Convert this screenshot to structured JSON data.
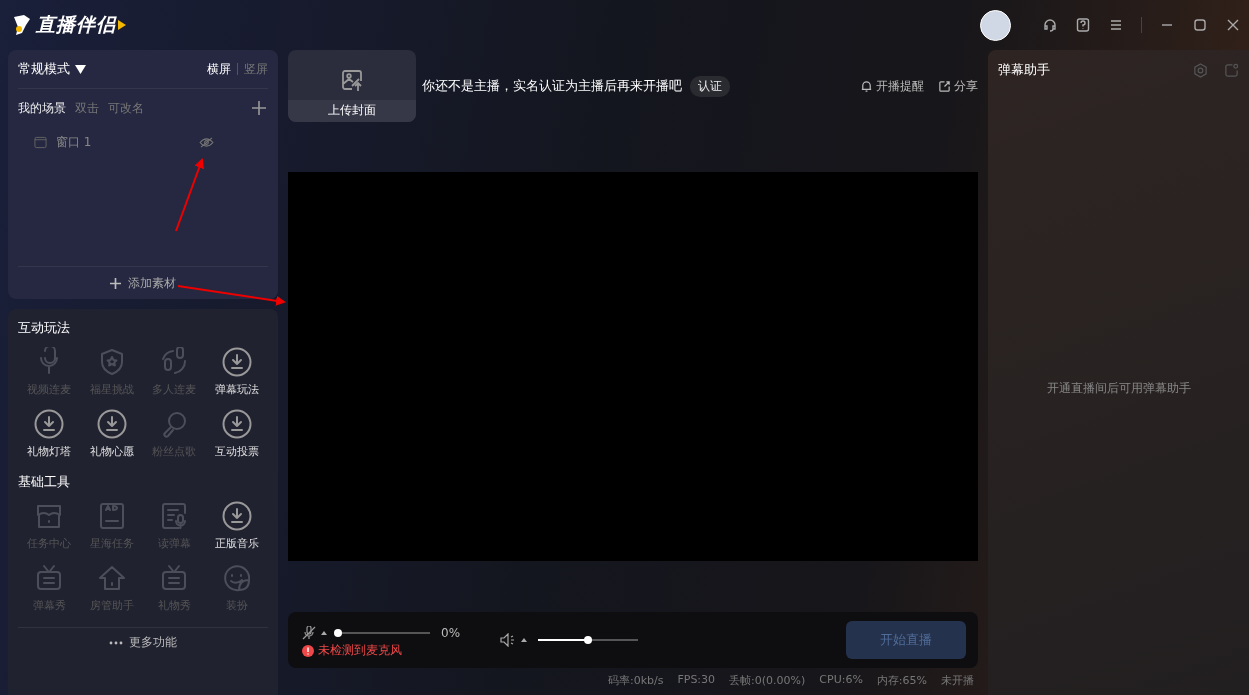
{
  "app": {
    "title": "直播伴侣"
  },
  "scenes": {
    "mode": "常规模式",
    "orientations": [
      {
        "label": "横屏",
        "selected": true
      },
      {
        "label": "竖屏",
        "selected": false
      }
    ],
    "title": "我的场景",
    "hint": [
      "双击",
      "可改名"
    ],
    "items": [
      {
        "label": "窗口 1",
        "visible": false
      }
    ],
    "add_label": "添加素材"
  },
  "tool_sections": [
    {
      "title": "互动玩法",
      "items": [
        {
          "label": "视频连麦",
          "kind": "mic",
          "disabled": true
        },
        {
          "label": "福星挑战",
          "kind": "shield",
          "disabled": true
        },
        {
          "label": "多人连麦",
          "kind": "multi",
          "disabled": true
        },
        {
          "label": "弹幕玩法",
          "kind": "download",
          "disabled": false
        },
        {
          "label": "礼物灯塔",
          "kind": "download",
          "disabled": false
        },
        {
          "label": "礼物心愿",
          "kind": "download",
          "disabled": false
        },
        {
          "label": "粉丝点歌",
          "kind": "note",
          "disabled": true
        },
        {
          "label": "互动投票",
          "kind": "download",
          "disabled": false
        }
      ]
    },
    {
      "title": "基础工具",
      "items": [
        {
          "label": "任务中心",
          "kind": "store",
          "disabled": true
        },
        {
          "label": "星海任务",
          "kind": "ad",
          "disabled": true
        },
        {
          "label": "读弹幕",
          "kind": "read",
          "disabled": true
        },
        {
          "label": "正版音乐",
          "kind": "download",
          "disabled": false
        },
        {
          "label": "弹幕秀",
          "kind": "tv",
          "disabled": true
        },
        {
          "label": "房管助手",
          "kind": "house",
          "disabled": true
        },
        {
          "label": "礼物秀",
          "kind": "tv",
          "disabled": true
        },
        {
          "label": "装扮",
          "kind": "smile",
          "disabled": true
        }
      ]
    }
  ],
  "more_label": "更多功能",
  "cover": {
    "label": "上传封面"
  },
  "notice": {
    "text": "你还不是主播，实名认证为主播后再来开播吧",
    "button": "认证"
  },
  "top_actions": [
    {
      "label": "开播提醒",
      "kind": "bell"
    },
    {
      "label": "分享",
      "kind": "share"
    }
  ],
  "controls": {
    "mic": {
      "muted": true,
      "level": 0,
      "reading": "0%",
      "warning": "未检测到麦克风"
    },
    "speaker": {
      "level": 0.5
    },
    "start_button": {
      "label": "开始直播",
      "disabled": true
    }
  },
  "status_bar": [
    "码率:0kb/s",
    "FPS:30",
    "丢帧:0(0.00%)",
    "CPU:6%",
    "内存:65%",
    "未开播"
  ],
  "danmu": {
    "title": "弹幕助手",
    "empty": "开通直播间后可用弹幕助手"
  }
}
